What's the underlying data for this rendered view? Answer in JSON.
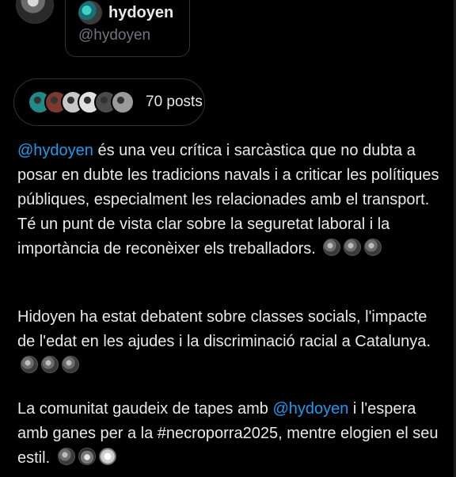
{
  "profile": {
    "display_name": "hydoyen",
    "handle": "@hydoyen"
  },
  "posts_summary": {
    "label": "70 posts",
    "avatar_colors": [
      "#1f8a86",
      "#7a3b2e",
      "#c7c7c7",
      "#e0e0e0",
      "#4a4a4a",
      "#9a9a9a"
    ]
  },
  "summary": {
    "p1_mention": "@hydoyen",
    "p1_text": " és una veu crítica i sarcàstica que no dubta a posar en dubte les tradicions navals i a criticar les polítiques públiques, especialment les relacionades amb el transport. Té un punt de vista clar sobre la seguretat laboral i la importància de reconèixer els treballadors.",
    "p2_text": "Hidoyen ha estat debatent sobre classes socials, l'impacte de l'edat en les ajudes i la discriminació racial a Catalunya.",
    "p3_text_a": "La comunitat gaudeix de tapes amb ",
    "p3_mention": "@hydoyen",
    "p3_text_b": " i l'espera amb ganes per a la #necroporra2025, mentre elogien el seu estil."
  },
  "colors": {
    "background": "#000000",
    "text": "#e7e9ea",
    "muted": "#71767b",
    "link": "#1d9bf0",
    "border": "#2f3336"
  }
}
